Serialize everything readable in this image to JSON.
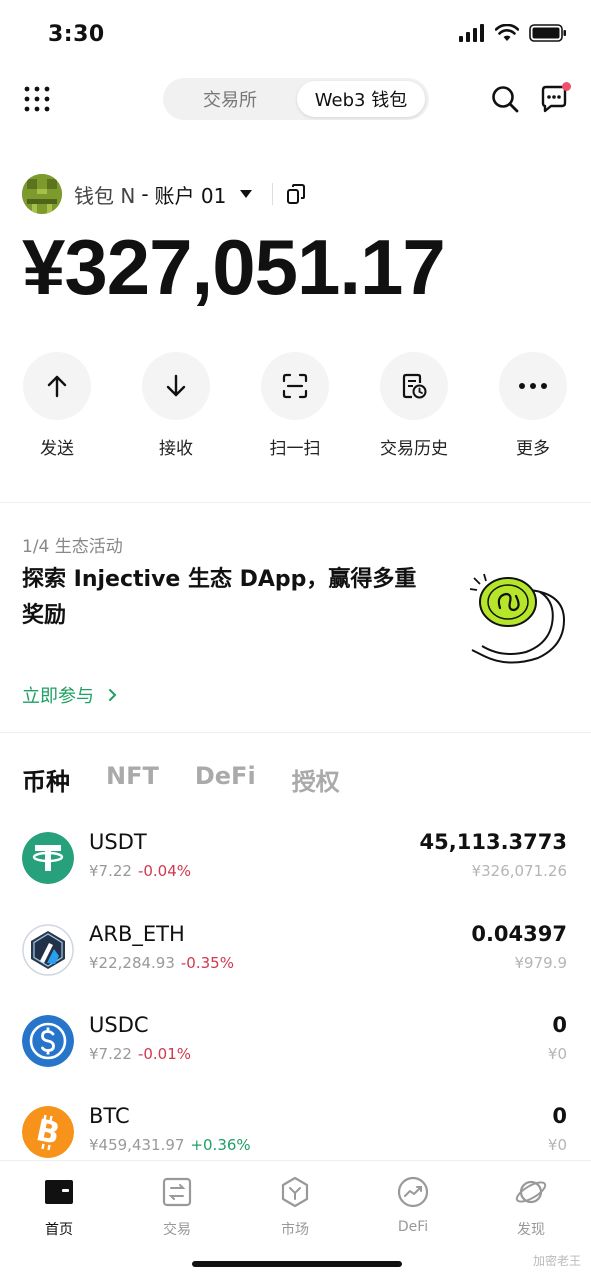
{
  "status": {
    "time": "3:30"
  },
  "header": {
    "tabs": [
      {
        "label": "交易所"
      },
      {
        "label": "Web3 钱包"
      }
    ],
    "notification_dot_color": "#f0506e"
  },
  "account": {
    "wallet": "钱包 N",
    "separator": "-",
    "name": "账户 01",
    "balance": "¥327,051.17"
  },
  "actions": [
    {
      "label": "发送",
      "icon": "arrow-up-icon"
    },
    {
      "label": "接收",
      "icon": "arrow-down-icon"
    },
    {
      "label": "扫一扫",
      "icon": "scan-icon"
    },
    {
      "label": "交易历史",
      "icon": "history-icon"
    },
    {
      "label": "更多",
      "icon": "more-icon"
    }
  ],
  "promo": {
    "counter": "1/4 生态活动",
    "title": "探索 Injective 生态 DApp，赢得多重奖励",
    "link": "立即参与",
    "accent": "#b6e629"
  },
  "asset_tabs": [
    "币种",
    "NFT",
    "DeFi",
    "授权"
  ],
  "tokens": [
    {
      "symbol": "USDT",
      "price": "¥7.22",
      "change": "-0.04%",
      "direction": "down",
      "amount": "45,113.3773",
      "value": "¥326,071.26",
      "icon": "usdt-icon",
      "color": "#26a17b"
    },
    {
      "symbol": "ARB_ETH",
      "price": "¥22,284.93",
      "change": "-0.35%",
      "direction": "down",
      "amount": "0.04397",
      "value": "¥979.9",
      "icon": "arbitrum-icon",
      "color": "#2d374b"
    },
    {
      "symbol": "USDC",
      "price": "¥7.22",
      "change": "-0.01%",
      "direction": "down",
      "amount": "0",
      "value": "¥0",
      "icon": "usdc-icon",
      "color": "#2775ca"
    },
    {
      "symbol": "BTC",
      "price": "¥459,431.97",
      "change": "+0.36%",
      "direction": "up",
      "amount": "0",
      "value": "¥0",
      "icon": "bitcoin-icon",
      "color": "#f7931a"
    }
  ],
  "bottom_nav": [
    {
      "label": "首页",
      "icon": "wallet-icon"
    },
    {
      "label": "交易",
      "icon": "swap-icon"
    },
    {
      "label": "市场",
      "icon": "market-icon"
    },
    {
      "label": "DeFi",
      "icon": "defi-icon"
    },
    {
      "label": "发现",
      "icon": "planet-icon"
    }
  ],
  "watermark": "加密老王"
}
